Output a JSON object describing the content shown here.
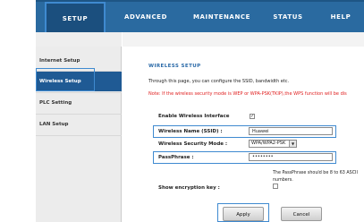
{
  "nav": {
    "tabs": [
      {
        "label": "SETUP",
        "active": true
      },
      {
        "label": "ADVANCED",
        "active": false
      },
      {
        "label": "MAINTENANCE",
        "active": false
      },
      {
        "label": "STATUS",
        "active": false
      },
      {
        "label": "HELP",
        "active": false
      }
    ]
  },
  "sidebar": {
    "items": [
      {
        "label": "Internet Setup",
        "active": false
      },
      {
        "label": "Wireless Setup",
        "active": true
      },
      {
        "label": "PLC Setting",
        "active": false
      },
      {
        "label": "LAN Setup",
        "active": false
      }
    ]
  },
  "main": {
    "title": "WIRELESS SETUP",
    "description": "Through this page, you can configure the SSID, bandwidth etc.",
    "note": "Note: If the wireless security mode is WEP or WPA-PSK(TKIP),the WPS function will be dis",
    "enable_label": "Enable Wireless Interface",
    "enable_checked": true,
    "ssid_label": "Wireless Name (SSID) :",
    "ssid_value": "Huawei",
    "security_label": "Wireless Security Mode :",
    "security_value": "WPA/WPA2-PSK",
    "passphrase_label": "PassPhrase :",
    "passphrase_value": "••••••••",
    "passphrase_hint": "The PassPhrase should be 8 to 63 ASCII numbers.",
    "show_key_label": "Show encryption key :",
    "show_key_checked": false
  },
  "buttons": {
    "apply": "Apply",
    "cancel": "Cancel"
  },
  "colors": {
    "nav_bg": "#2a6aa0",
    "nav_active": "#1b4f7e",
    "sidebar_active": "#1f5a94",
    "highlight": "#3f8ad0",
    "note": "#e02020"
  }
}
